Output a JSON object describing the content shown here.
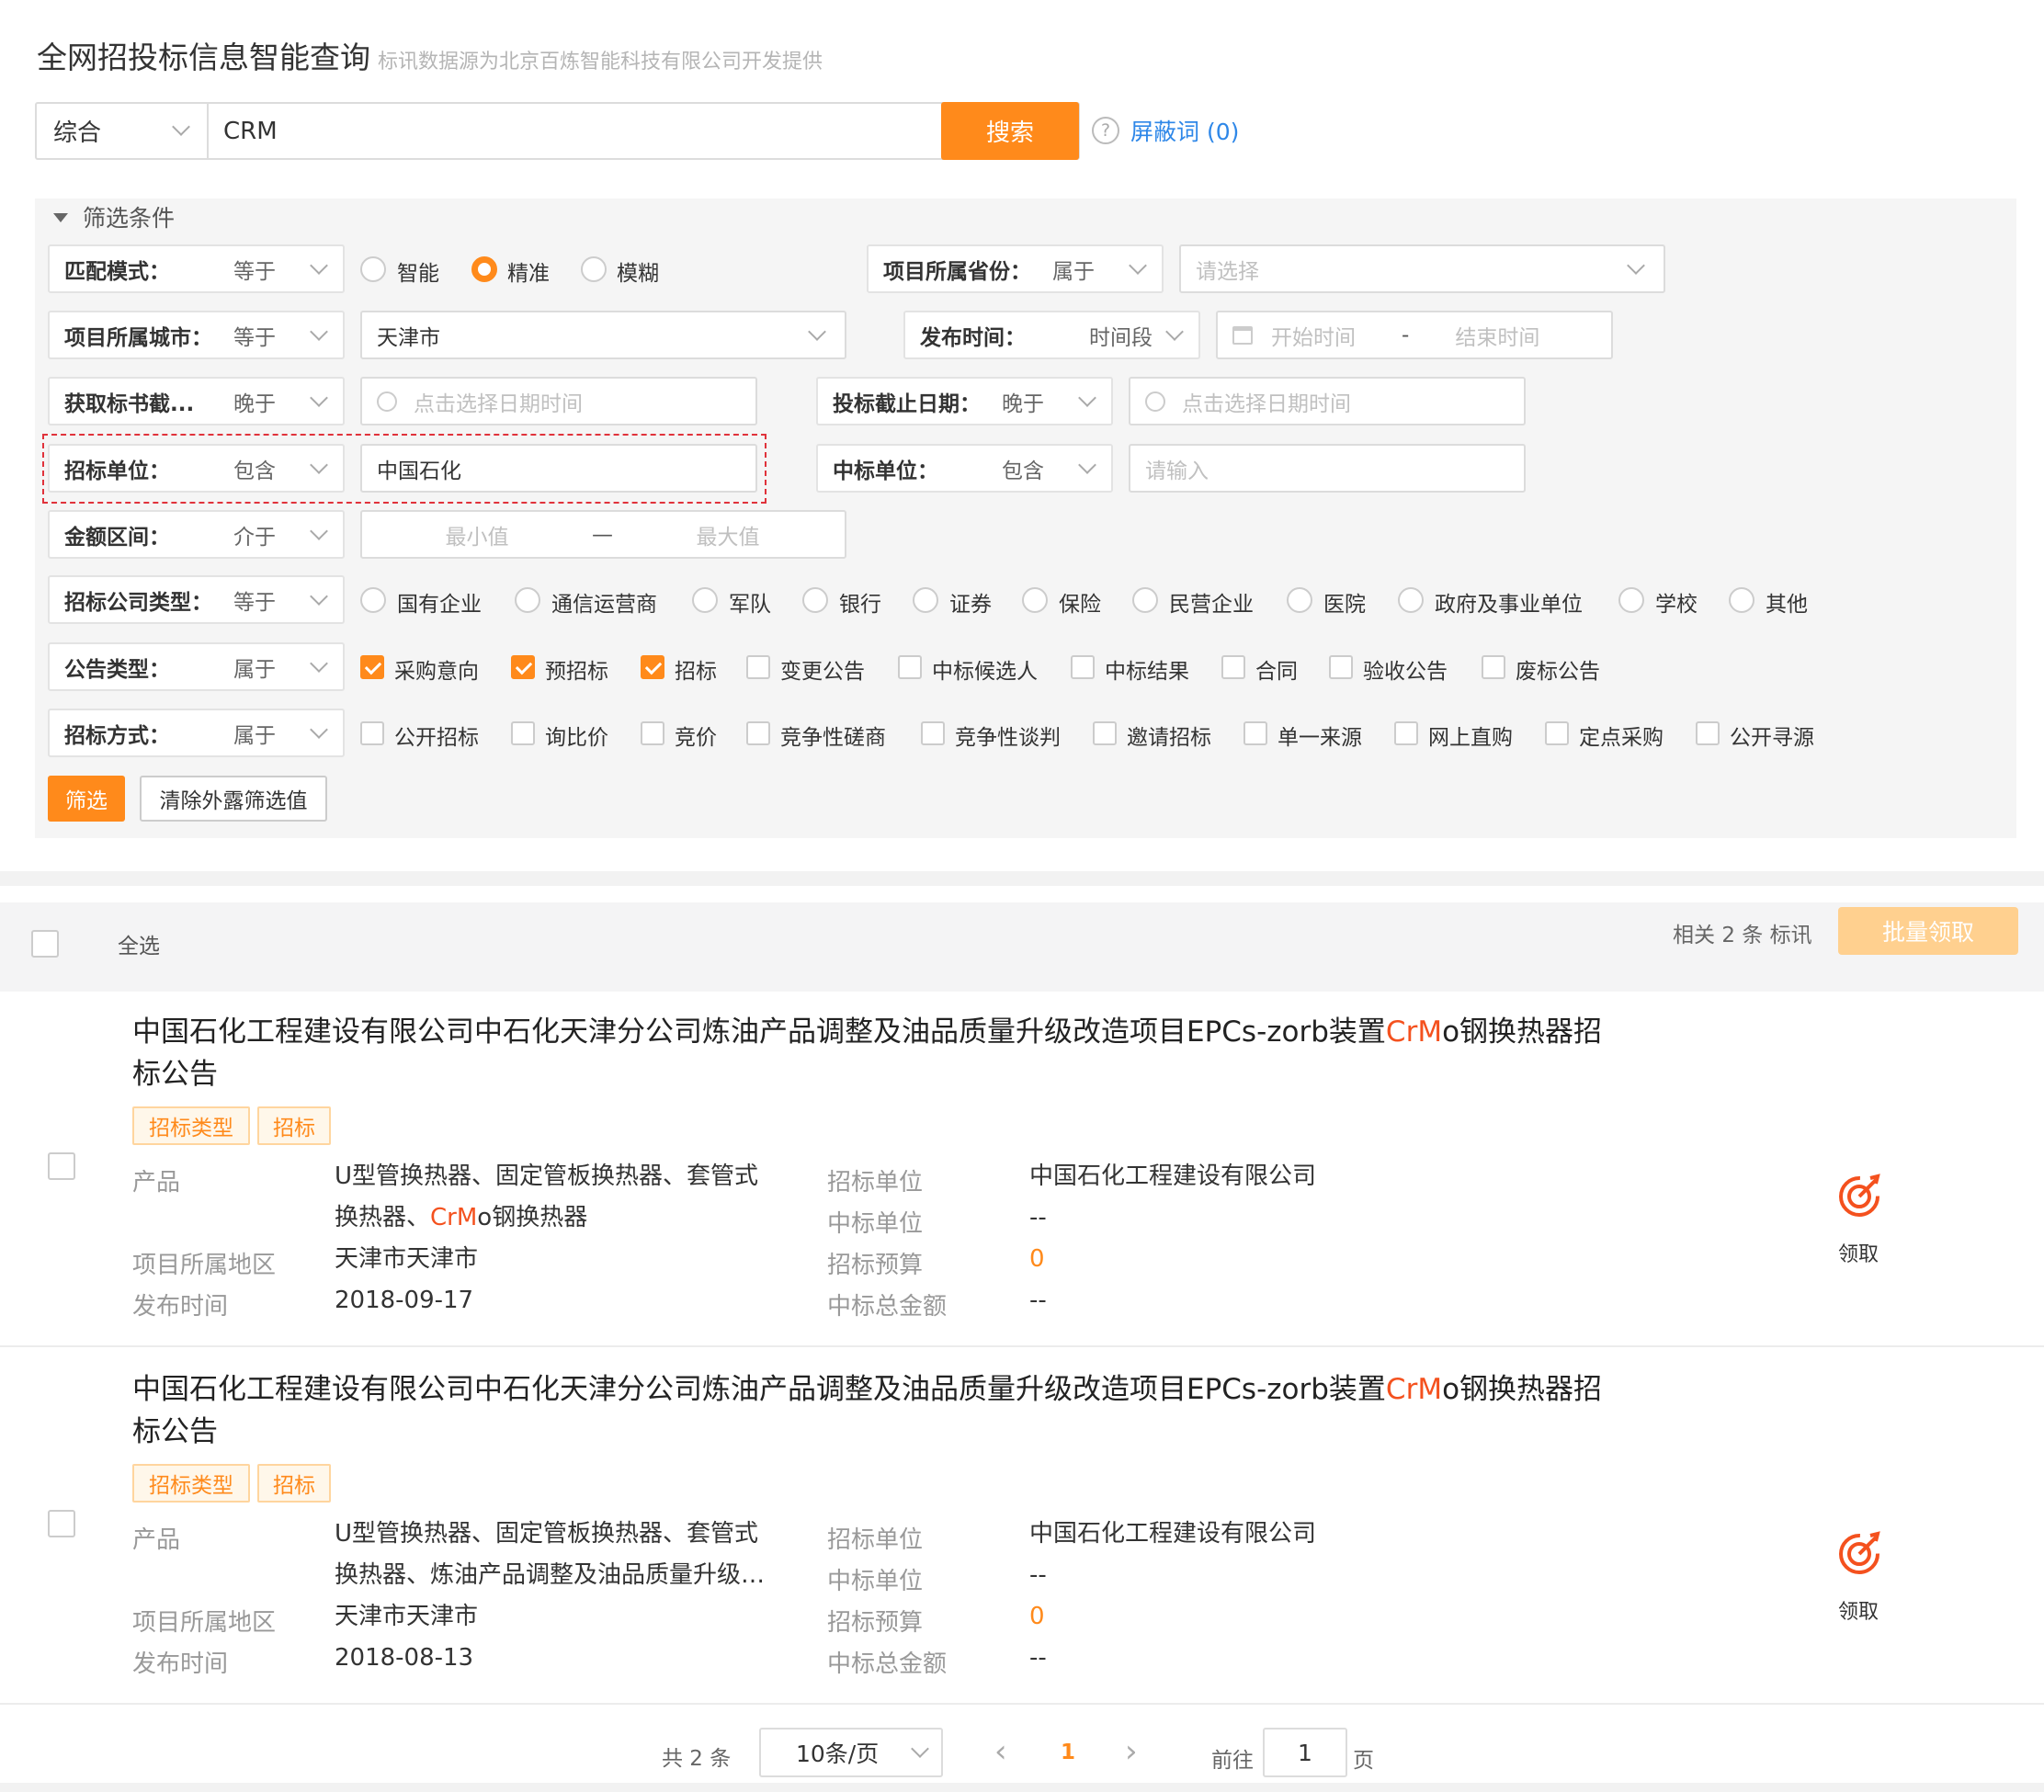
{
  "header": {
    "title": "全网招投标信息智能查询",
    "subtitle": "标讯数据源为北京百炼智能科技有限公司开发提供"
  },
  "search": {
    "category": "综合",
    "query": "CRM",
    "button": "搜索",
    "shield_label": "屏蔽词",
    "shield_count": "(0)"
  },
  "filters": {
    "section_title": "筛选条件",
    "match_mode": {
      "label": "匹配模式：",
      "op": "等于",
      "options": [
        "智能",
        "精准",
        "模糊"
      ],
      "selected": "精准"
    },
    "province": {
      "label": "项目所属省份：",
      "op": "属于",
      "placeholder": "请选择"
    },
    "city": {
      "label": "项目所属城市：",
      "op": "等于",
      "value": "天津市"
    },
    "publish_time": {
      "label": "发布时间：",
      "op": "时间段",
      "start": "开始时间",
      "sep": "-",
      "end": "结束时间"
    },
    "doc_deadline": {
      "label": "获取标书截...",
      "op": "晚于",
      "placeholder": "点击选择日期时间"
    },
    "bid_deadline": {
      "label": "投标截止日期：",
      "op": "晚于",
      "placeholder": "点击选择日期时间"
    },
    "tender_unit": {
      "label": "招标单位：",
      "op": "包含",
      "value": "中国石化"
    },
    "winner_unit": {
      "label": "中标单位：",
      "op": "包含",
      "placeholder": "请输入"
    },
    "amount": {
      "label": "金额区间：",
      "op": "介于",
      "min": "最小值",
      "sep": "—",
      "max": "最大值"
    },
    "company_type": {
      "label": "招标公司类型：",
      "op": "等于",
      "options": [
        "国有企业",
        "通信运营商",
        "军队",
        "银行",
        "证券",
        "保险",
        "民营企业",
        "医院",
        "政府及事业单位",
        "学校",
        "其他"
      ]
    },
    "notice_type": {
      "label": "公告类型：",
      "op": "属于",
      "options": [
        {
          "text": "采购意向",
          "checked": true
        },
        {
          "text": "预招标",
          "checked": true
        },
        {
          "text": "招标",
          "checked": true
        },
        {
          "text": "变更公告",
          "checked": false
        },
        {
          "text": "中标候选人",
          "checked": false
        },
        {
          "text": "中标结果",
          "checked": false
        },
        {
          "text": "合同",
          "checked": false
        },
        {
          "text": "验收公告",
          "checked": false
        },
        {
          "text": "废标公告",
          "checked": false
        }
      ]
    },
    "method": {
      "label": "招标方式：",
      "op": "属于",
      "options": [
        "公开招标",
        "询比价",
        "竞价",
        "竞争性磋商",
        "竞争性谈判",
        "邀请招标",
        "单一来源",
        "网上直购",
        "定点采购",
        "公开寻源"
      ]
    },
    "btn_filter": "筛选",
    "btn_clear": "清除外露筛选值"
  },
  "list": {
    "select_all": "全选",
    "related_prefix": "相关",
    "related_count": "2",
    "related_suffix": "条 标讯",
    "batch_btn": "批量领取",
    "labels": {
      "product": "产品",
      "region": "项目所属地区",
      "time": "发布时间",
      "tender": "招标单位",
      "winner": "中标单位",
      "budget": "招标预算",
      "total": "中标总金额",
      "claim": "领取"
    },
    "items": [
      {
        "title_pre": "中国石化工程建设有限公司中石化天津分公司炼油产品调整及油品质量升级改造项目EPCs-zorb装置",
        "title_hl": "CrM",
        "title_post": "o钢换热器招",
        "title_line2": "标公告",
        "tags": [
          "招标类型",
          "招标"
        ],
        "product_line1": "U型管换热器、固定管板换热器、套管式",
        "product_line2_pre": "换热器、",
        "product_line2_hl": "CrM",
        "product_line2_post": "o钢换热器",
        "region": "天津市天津市",
        "time": "2018-09-17",
        "tender": "中国石化工程建设有限公司",
        "winner": "--",
        "budget": "0",
        "total": "--"
      },
      {
        "title_pre": "中国石化工程建设有限公司中石化天津分公司炼油产品调整及油品质量升级改造项目EPCs-zorb装置",
        "title_hl": "CrM",
        "title_post": "o钢换热器招",
        "title_line2": "标公告",
        "tags": [
          "招标类型",
          "招标"
        ],
        "product_line1": "U型管换热器、固定管板换热器、套管式",
        "product_line2_pre": "换热器、炼油产品调整及油品质量升级…",
        "product_line2_hl": "",
        "product_line2_post": "",
        "region": "天津市天津市",
        "time": "2018-08-13",
        "tender": "中国石化工程建设有限公司",
        "winner": "--",
        "budget": "0",
        "total": "--"
      }
    ]
  },
  "pagination": {
    "total": "共 2 条",
    "page_size": "10条/页",
    "current": "1",
    "goto": "前往",
    "goto_value": "1",
    "page_unit": "页",
    "prev": "‹",
    "next": "›"
  },
  "colors": {
    "accent": "#ff8a1b",
    "link": "#2e87e8",
    "highlight": "#f4511e"
  }
}
